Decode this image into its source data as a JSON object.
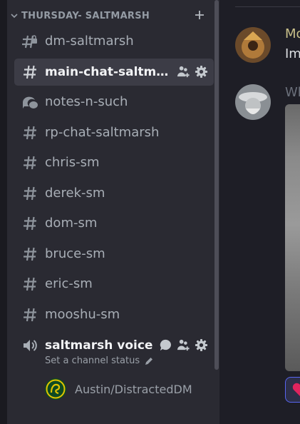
{
  "sidebar": {
    "category": {
      "title": "THURSDAY- SALTMARSH"
    },
    "channels": [
      {
        "label": "dm-saltmarsh",
        "icon": "locked-hash-icon"
      },
      {
        "label": "main-chat-saltmarsh",
        "icon": "hash-icon",
        "selected": true
      },
      {
        "label": "notes-n-such",
        "icon": "forum-icon"
      },
      {
        "label": "rp-chat-saltmarsh",
        "icon": "hash-icon"
      },
      {
        "label": "chris-sm",
        "icon": "hash-icon"
      },
      {
        "label": "derek-sm",
        "icon": "hash-icon"
      },
      {
        "label": "dom-sm",
        "icon": "hash-icon"
      },
      {
        "label": "bruce-sm",
        "icon": "hash-icon"
      },
      {
        "label": "eric-sm",
        "icon": "hash-icon"
      },
      {
        "label": "mooshu-sm",
        "icon": "hash-icon"
      }
    ],
    "voice": {
      "label": "saltmarsh voice",
      "status": "Set a channel status",
      "user": "Austin/DistractedDM"
    }
  },
  "main": {
    "messages": [
      {
        "author": "Mo",
        "text": "Im",
        "author_color": "#c9c08a"
      },
      {
        "author": "Wh",
        "text": "",
        "author_color": "#6a6f7a"
      }
    ],
    "reaction_color": "#e0245e"
  }
}
